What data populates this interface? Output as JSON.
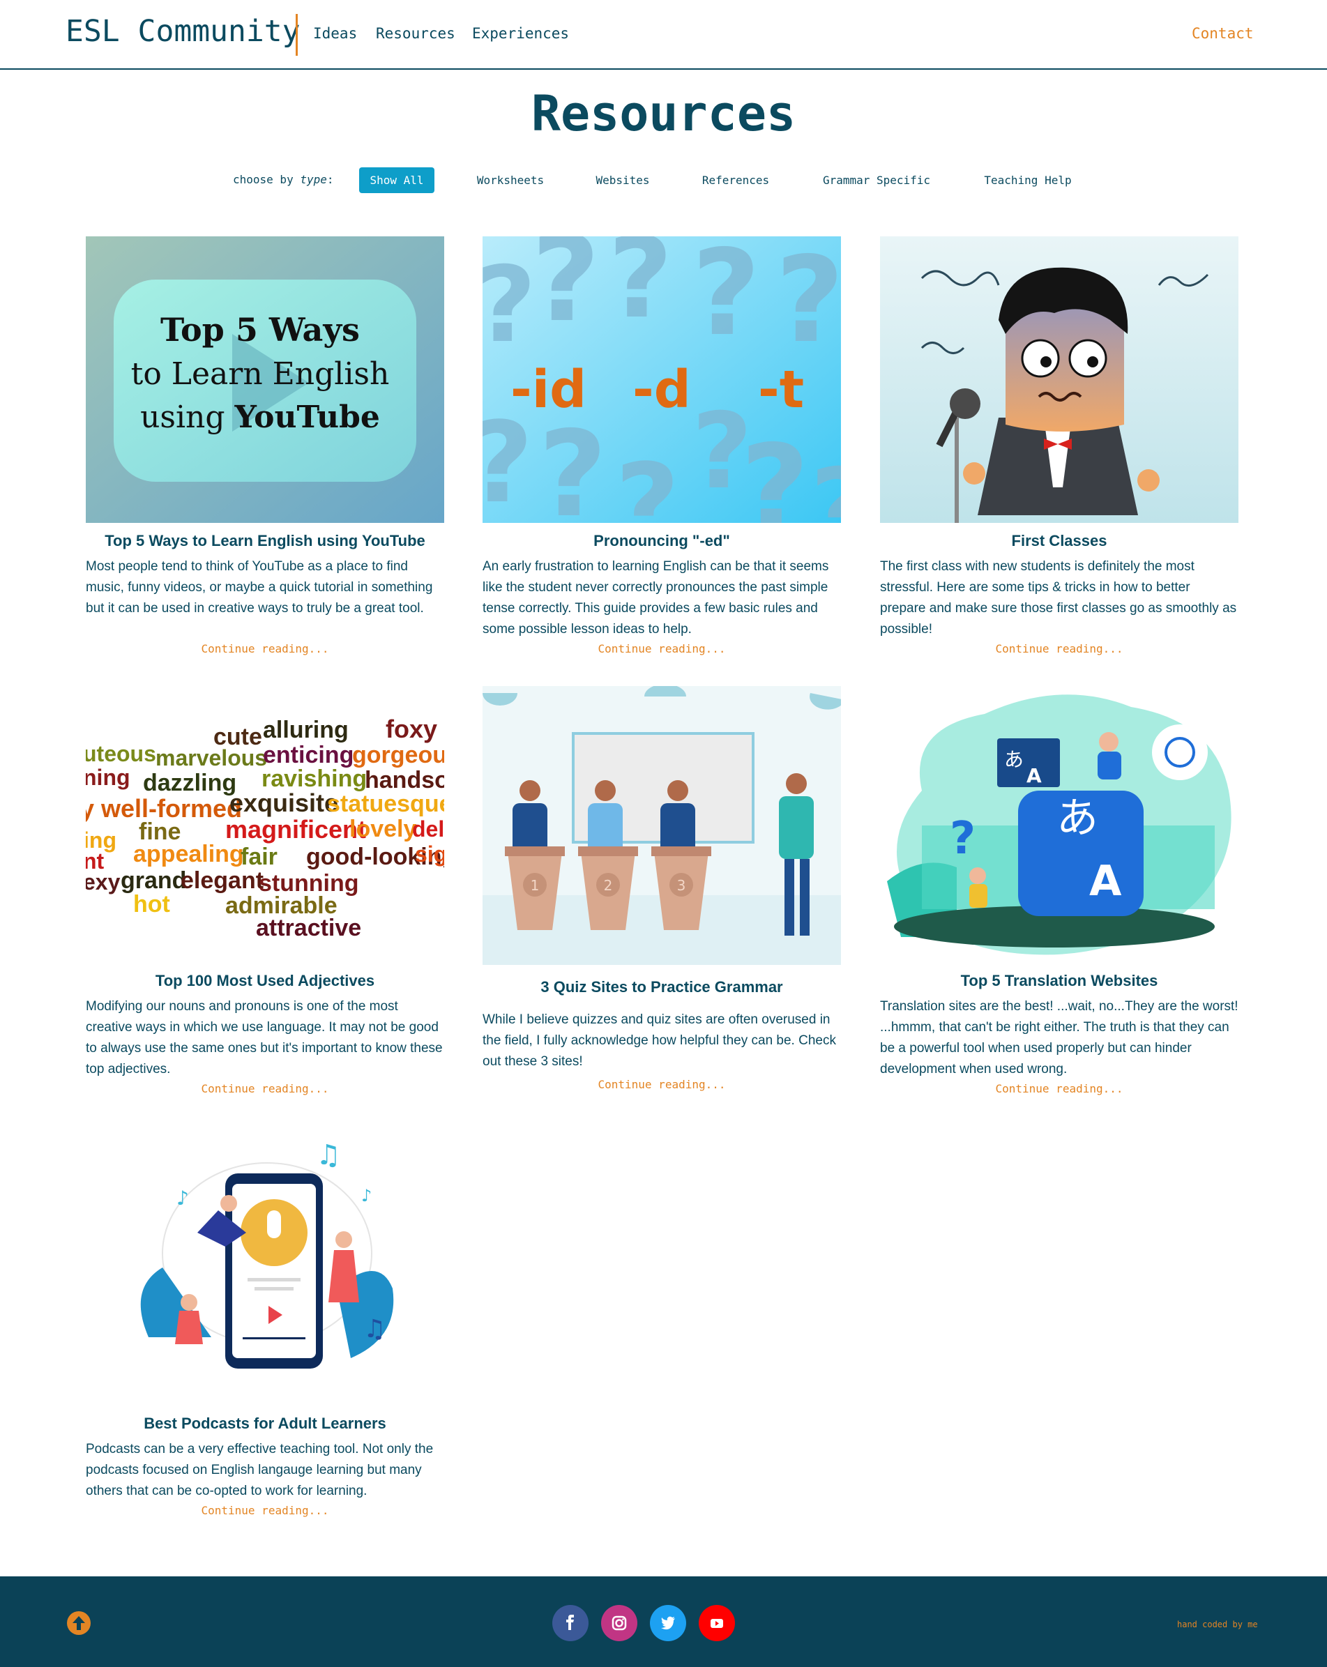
{
  "nav": {
    "brand": "ESL Community",
    "links": [
      "Ideas",
      "Resources",
      "Experiences"
    ],
    "contact": "Contact"
  },
  "page": {
    "title": "Resources"
  },
  "filter": {
    "label_prefix": "choose by",
    "label_type": "type",
    "label_suffix": ":",
    "buttons": [
      "Show All",
      "Worksheets",
      "Websites",
      "References",
      "Grammar Specific",
      "Teaching Help"
    ],
    "active": "Show All"
  },
  "cards": [
    {
      "title": "Top 5 Ways to Learn English using YouTube",
      "description": "Most people tend to think of YouTube as a place to find music, funny videos, or maybe a quick tutorial in something but it can be used in creative ways to truly be a great tool.",
      "more": "Continue reading...",
      "image_text": {
        "line1": "Top 5 Ways",
        "line2": "to Learn English",
        "line3a": "using ",
        "line3b": "YouTube"
      }
    },
    {
      "title": "Pronouncing \"-ed\"",
      "description": "An early frustration to learning English can be that it seems like the student never correctly pronounces the past simple tense correctly. This guide provides a few basic rules and some possible lesson ideas to help.",
      "more": "Continue reading...",
      "image_text": {
        "e1": "-id",
        "e2": "-d",
        "e3": "-t"
      }
    },
    {
      "title": "First Classes",
      "description": "The first class with new students is definitely the most stressful. Here are some tips & tricks in how to better prepare and make sure those first classes go as smoothly as possible!",
      "more": "Continue reading..."
    },
    {
      "title": "Top 100 Most Used Adjectives",
      "description": "Modifying our nouns and pronouns is one of the most creative ways in which we use language. It may not be good to always use the same ones but it's important to know these top adjectives.",
      "more": "Continue reading...",
      "words": [
        "uteous",
        "ning",
        "y well-formed",
        "ing",
        "nt",
        "exy",
        "cute",
        "marvelous",
        "dazzling",
        "fine",
        "appealing",
        "grand",
        "hot",
        "alluring",
        "enticing",
        "ravishing",
        "exquisite",
        "magnificent",
        "fair",
        "elegant",
        "stunning",
        "admirable",
        "attractive",
        "foxy",
        "gorgeous",
        "handsome",
        "statuesque",
        "lovely",
        "good-looking",
        "sig",
        "del"
      ]
    },
    {
      "title": "3 Quiz Sites to Practice Grammar",
      "description": "While I believe quizzes and quiz sites are often overused in the field, I fully acknowledge how helpful they can be. Check out these 3 sites!",
      "more": "Continue reading...",
      "podium_numbers": [
        "1",
        "2",
        "3"
      ]
    },
    {
      "title": "Top 5 Translation Websites",
      "description": "Translation sites are the best! ...wait, no...They are the worst! ...hmmm, that can't be right either. The truth is that they can be a powerful tool when used properly but can hinder development when used wrong.",
      "more": "Continue reading...",
      "glyphs": {
        "kana": "あ",
        "latin": "A",
        "q": "?"
      }
    },
    {
      "title": "Best Podcasts for Adult Learners",
      "description": "Podcasts can be a very effective teaching tool. Not only the podcasts focused on English langauge learning but many others that can be co-opted to work for learning.",
      "more": "Continue reading..."
    }
  ],
  "footer": {
    "credit": "hand coded by me",
    "social": [
      "facebook-icon",
      "instagram-icon",
      "twitter-icon",
      "youtube-icon"
    ],
    "social_colors": [
      "#3b5998",
      "#c13584",
      "#1da1f2",
      "#ff0000"
    ],
    "accent": "#e38524",
    "background": "#0b4257"
  }
}
